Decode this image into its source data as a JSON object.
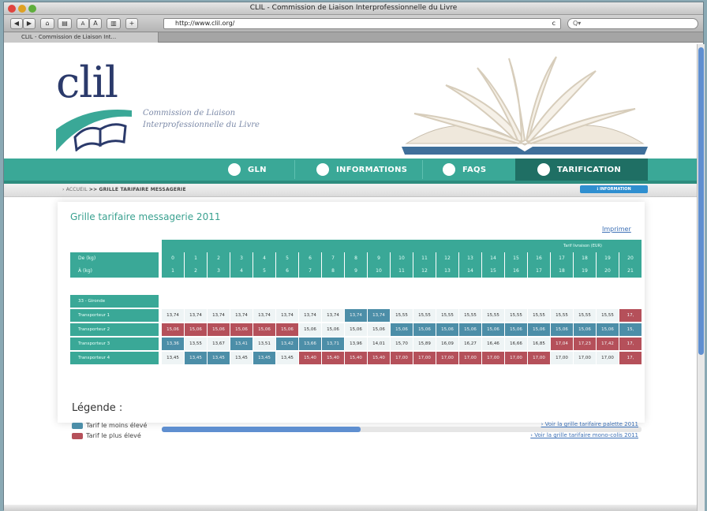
{
  "browser": {
    "title": "CLIL - Commission de Liaison Interprofessionnelle du Livre",
    "url": "http://www.clil.org/",
    "search_placeholder": "Q▾",
    "tab_label": "CLIL - Commission de Liaison Int...",
    "reload_symbol": "c"
  },
  "header": {
    "logo_text": "clil",
    "tagline_line1": "Commission de Liaison",
    "tagline_line2": "Interprofessionnelle du Livre"
  },
  "nav": {
    "items": [
      {
        "label": "GLN"
      },
      {
        "label": "INFORMATIONS"
      },
      {
        "label": "FAQS"
      },
      {
        "label": "TARIFICATION"
      }
    ]
  },
  "breadcrumb": {
    "home": "› ACCUEIL",
    "sep": ">>",
    "current": "GRILLE TARIFAIRE MESSAGERIE",
    "info_button": "ℹ INFORMATION"
  },
  "content": {
    "title": "Grille tarifaire messagerie 2011",
    "print_link": "Imprimer",
    "table": {
      "super_header": "Tarif livraison (EUR)",
      "row_headers": [
        "De (kg)",
        "À (kg)"
      ],
      "from_values": [
        "0",
        "1",
        "2",
        "3",
        "4",
        "5",
        "6",
        "7",
        "8",
        "9",
        "10",
        "11",
        "12",
        "13",
        "14",
        "15",
        "16",
        "17",
        "18",
        "19",
        "20"
      ],
      "to_values": [
        "1",
        "2",
        "3",
        "4",
        "5",
        "6",
        "7",
        "8",
        "9",
        "10",
        "11",
        "12",
        "13",
        "14",
        "15",
        "16",
        "17",
        "18",
        "19",
        "20",
        "21"
      ],
      "zone_label": "33 - Gironde",
      "transporters": [
        {
          "name": "Transporteur 1",
          "values": [
            "13,74",
            "13,74",
            "13,74",
            "13,74",
            "13,74",
            "13,74",
            "13,74",
            "13,74",
            "13,74",
            "13,74",
            "15,55",
            "15,55",
            "15,55",
            "15,55",
            "15,55",
            "15,55",
            "15,55",
            "15,55",
            "15,55",
            "15,55",
            "17,"
          ]
        },
        {
          "name": "Transporteur 2",
          "values": [
            "15,06",
            "15,06",
            "15,06",
            "15,06",
            "15,06",
            "15,06",
            "15,06",
            "15,06",
            "15,06",
            "15,06",
            "15,06",
            "15,06",
            "15,06",
            "15,06",
            "15,06",
            "15,06",
            "15,06",
            "15,06",
            "15,06",
            "15,06",
            "15,"
          ]
        },
        {
          "name": "Transporteur 3",
          "values": [
            "13,36",
            "13,55",
            "13,67",
            "13,41",
            "13,51",
            "13,42",
            "13,66",
            "13,71",
            "13,96",
            "14,01",
            "15,70",
            "15,89",
            "16,09",
            "16,27",
            "16,46",
            "16,66",
            "16,85",
            "17,04",
            "17,23",
            "17,42",
            "17,"
          ]
        },
        {
          "name": "Transporteur 4",
          "values": [
            "13,45",
            "13,45",
            "13,45",
            "13,45",
            "13,45",
            "13,45",
            "15,40",
            "15,40",
            "15,40",
            "15,40",
            "17,00",
            "17,00",
            "17,00",
            "17,00",
            "17,00",
            "17,00",
            "17,00",
            "17,00",
            "17,00",
            "17,00",
            "17,"
          ]
        }
      ]
    }
  },
  "legend": {
    "title": "Légende :",
    "low_label": "Tarif le moins élevé",
    "high_label": "Tarif le plus élevé",
    "low_color": "#4c8ea8",
    "high_color": "#b5505a",
    "link_pallet": "› Voir la grille tarifaire palette 2011",
    "link_monocolis": "› Voir la grille tarifaire mono-colis 2011"
  },
  "colors": {
    "teal": "#3aa897",
    "low": "#4c8ea8",
    "high": "#b5505a"
  }
}
